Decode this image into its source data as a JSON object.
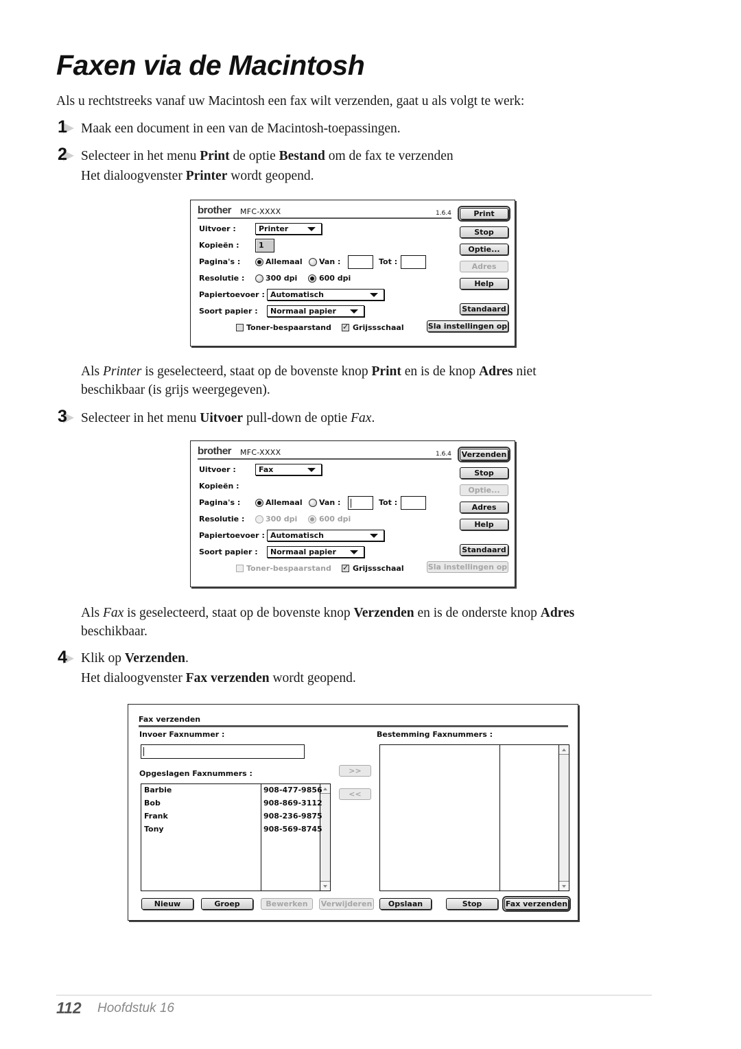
{
  "page": {
    "title": "Faxen via de Macintosh",
    "intro": "Als u rechtstreeks vanaf uw Macintosh een fax wilt verzenden, gaat u als volgt te werk:",
    "steps": [
      {
        "number": "1",
        "text": "Maak een document in een van de Macintosh-toepassingen."
      },
      {
        "number": "2",
        "line1_pre": "Selecteer in het menu ",
        "line1_b1": "Print",
        "line1_mid": " de optie ",
        "line1_b2": "Bestand",
        "line1_post": " om de fax te verzenden",
        "line2_pre": "Het dialoogvenster ",
        "line2_b": "Printer",
        "line2_post": " wordt geopend."
      },
      {
        "number": "3",
        "pre": "Selecteer in het menu ",
        "b": "Uitvoer",
        "mid": " pull-down de optie ",
        "i": "Fax",
        "post": "."
      },
      {
        "number": "4",
        "line1_pre": "Klik op ",
        "line1_b": "Verzenden",
        "line1_post": ".",
        "line2_pre": "Het dialoogvenster ",
        "line2_b": "Fax verzenden",
        "line2_post": " wordt geopend."
      }
    ],
    "note_printer": {
      "pre": "Als ",
      "i": "Printer",
      "mid1": " is geselecteerd, staat op de bovenste knop ",
      "b1": "Print",
      "mid2": " en is de knop ",
      "b2": "Adres",
      "post": " niet",
      "line2": "beschikbaar (is grijs weergegeven)."
    },
    "note_fax": {
      "pre": "Als ",
      "i": "Fax",
      "mid1": " is geselecteerd, staat op de bovenste knop ",
      "b1": "Verzenden",
      "mid2": " en is de onderste knop ",
      "b2": "Adres",
      "line2": "beschikbaar."
    },
    "footer": {
      "page_number": "112",
      "chapter": "Hoofdstuk 16"
    }
  },
  "dialog_printer": {
    "brand": "brother",
    "model": "MFC-XXXX",
    "version": "1.6.4",
    "labels": {
      "output": "Uitvoer :",
      "copies": "Kopieën :",
      "pages": "Pagina's :",
      "resolution": "Resolutie :",
      "paper_feed": "Papiertoevoer :",
      "paper_type": "Soort papier :"
    },
    "output_value": "Printer",
    "copies_value": "1",
    "pages_all": "Allemaal",
    "pages_from": "Van :",
    "pages_to": "Tot :",
    "pages_selected": "Allemaal",
    "res_300": "300 dpi",
    "res_600": "600 dpi",
    "resolution_selected": "600 dpi",
    "paper_feed_value": "Automatisch",
    "paper_type_value": "Normaal papier",
    "toner_save": "Toner-bespaarstand",
    "toner_save_checked": false,
    "grayscale": "Grijssschaal",
    "grayscale_checked": true,
    "buttons": {
      "primary": "Print",
      "stop": "Stop",
      "options": "Optie...",
      "address": "Adres",
      "help": "Help",
      "default": "Standaard",
      "save": "Sla instellingen op"
    },
    "disabled_buttons": [
      "Adres"
    ]
  },
  "dialog_fax": {
    "brand": "brother",
    "model": "MFC-XXXX",
    "version": "1.6.4",
    "labels": {
      "output": "Uitvoer :",
      "copies": "Kopieën :",
      "pages": "Pagina's :",
      "resolution": "Resolutie :",
      "paper_feed": "Papiertoevoer :",
      "paper_type": "Soort papier :"
    },
    "output_value": "Fax",
    "pages_all": "Allemaal",
    "pages_from": "Van :",
    "pages_to": "Tot :",
    "pages_selected": "Allemaal",
    "res_300": "300 dpi",
    "res_600": "600 dpi",
    "resolution_selected": "600 dpi",
    "paper_feed_value": "Automatisch",
    "paper_type_value": "Normaal papier",
    "toner_save": "Toner-bespaarstand",
    "toner_save_checked": false,
    "grayscale": "Grijssschaal",
    "grayscale_checked": true,
    "buttons": {
      "primary": "Verzenden",
      "stop": "Stop",
      "options": "Optie...",
      "address": "Adres",
      "help": "Help",
      "default": "Standaard",
      "save": "Sla instellingen op"
    },
    "disabled_buttons": [
      "Optie...",
      "Sla instellingen op"
    ]
  },
  "dialog_send": {
    "title": "Fax verzenden",
    "input_label": "Invoer Faxnummer :",
    "input_value": "",
    "saved_label": "Opgeslagen Faxnummers :",
    "dest_label": "Bestemming Faxnummers :",
    "add_button": ">>",
    "remove_button": "<<",
    "saved_entries": [
      {
        "name": "Barbie",
        "number": "908-477-9856"
      },
      {
        "name": "Bob",
        "number": "908-869-3112"
      },
      {
        "name": "Frank",
        "number": "908-236-9875"
      },
      {
        "name": "Tony",
        "number": "908-569-8745"
      }
    ],
    "buttons": {
      "new": "Nieuw",
      "group": "Groep",
      "edit": "Bewerken",
      "delete": "Verwijderen",
      "save": "Opslaan",
      "stop": "Stop",
      "send": "Fax verzenden"
    },
    "disabled_buttons": [
      "Bewerken",
      "Verwijderen"
    ]
  }
}
